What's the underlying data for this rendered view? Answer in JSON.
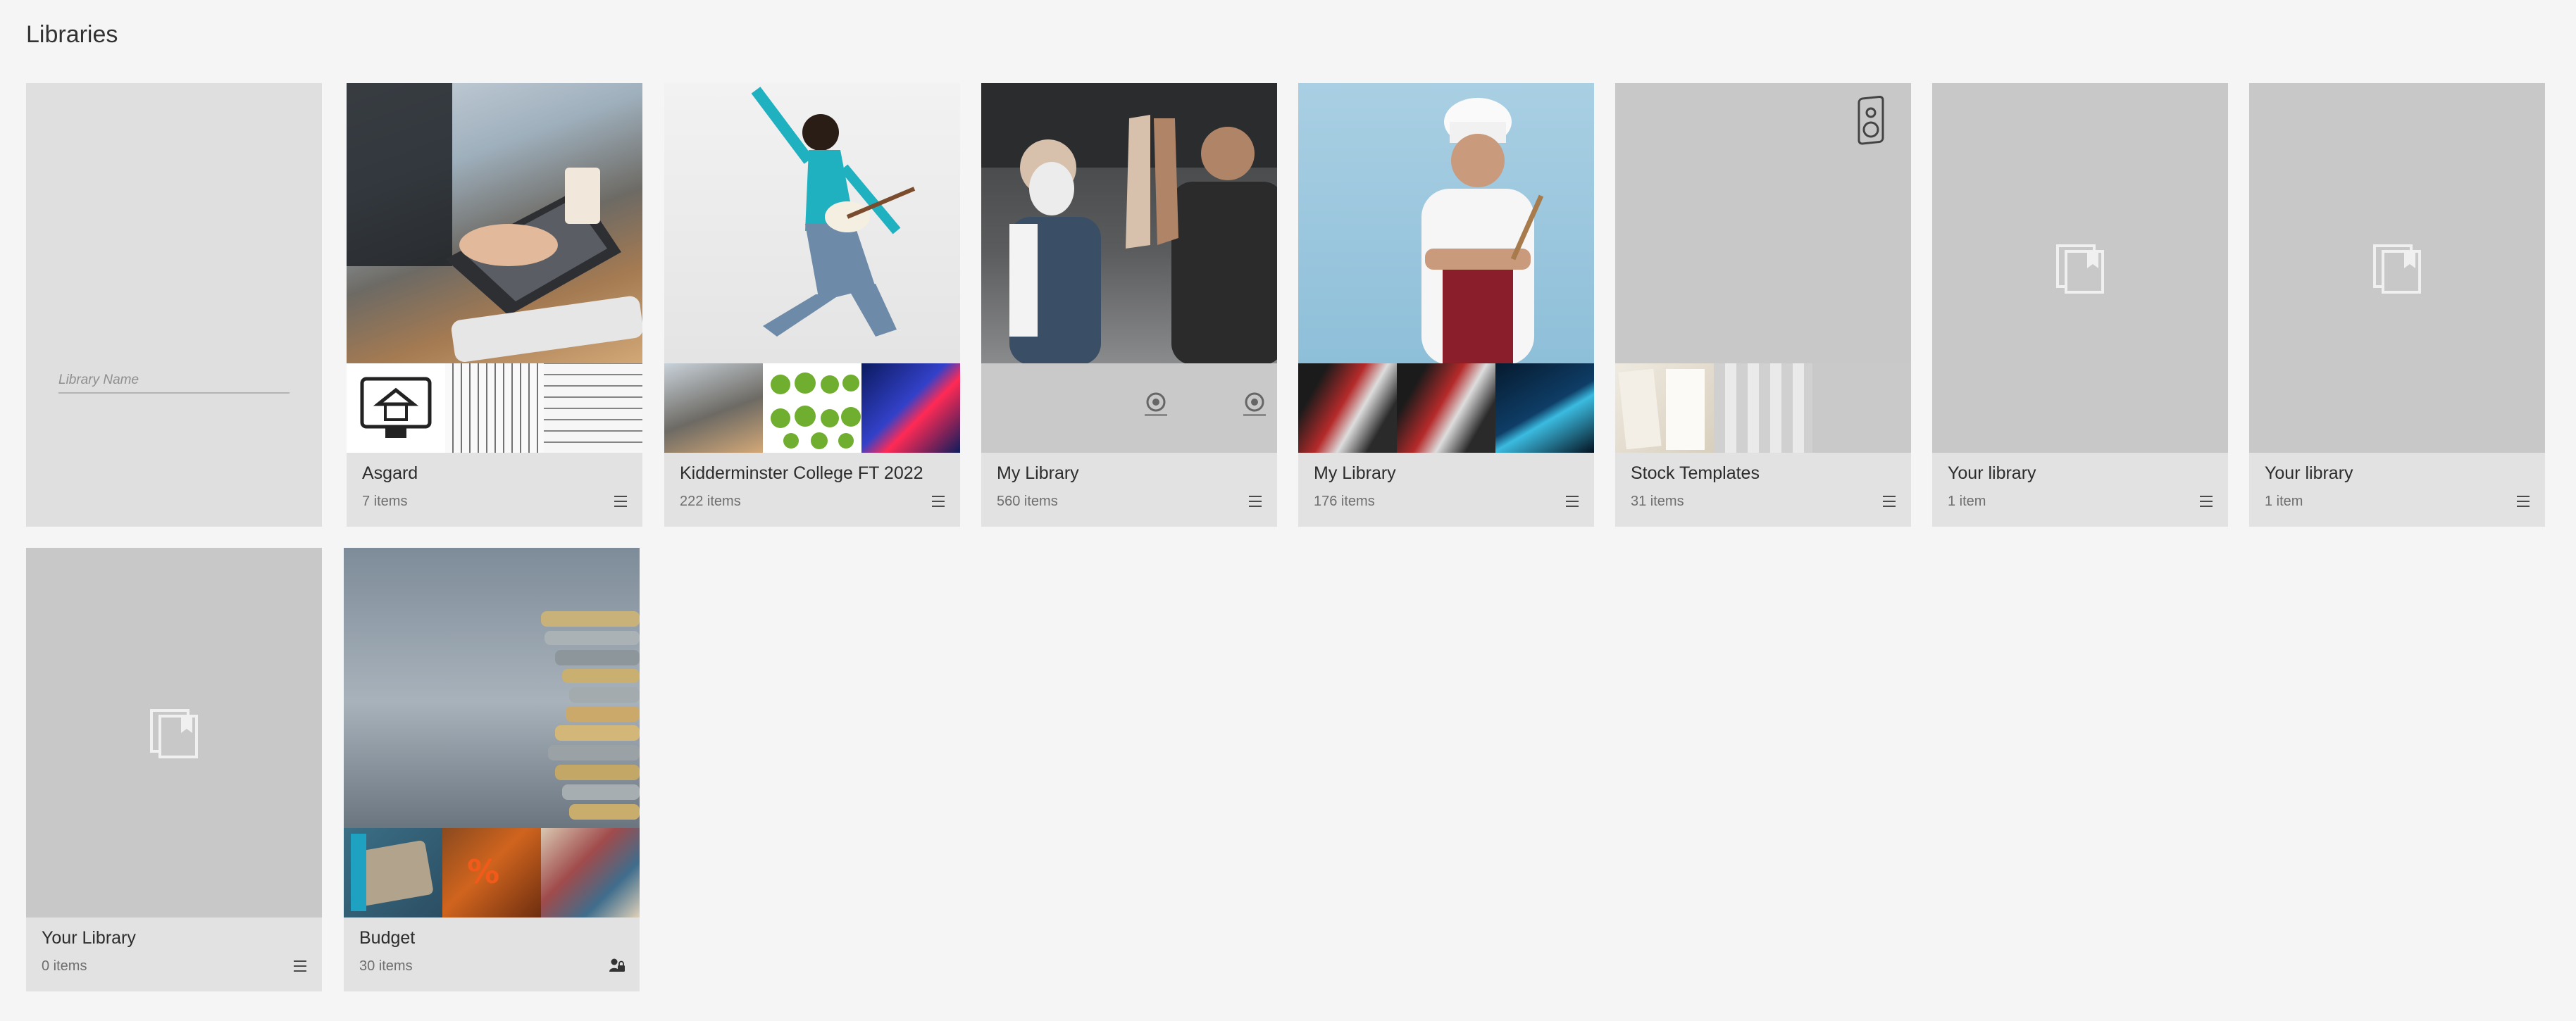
{
  "page": {
    "title": "Libraries"
  },
  "new_library": {
    "placeholder": "Library Name"
  },
  "libraries": [
    {
      "name": "Asgard",
      "count": "7 items",
      "action": "menu"
    },
    {
      "name": "Kidderminster College FT 2022",
      "count": "222 items",
      "action": "menu"
    },
    {
      "name": "My Library",
      "count": "560 items",
      "action": "menu"
    },
    {
      "name": "My Library",
      "count": "176 items",
      "action": "menu"
    },
    {
      "name": "Stock Templates",
      "count": "31 items",
      "action": "menu"
    },
    {
      "name": "Your library",
      "count": "1 item",
      "action": "menu"
    },
    {
      "name": "Your library",
      "count": "1 item",
      "action": "menu"
    },
    {
      "name": "Your Library",
      "count": "0 items",
      "action": "menu"
    },
    {
      "name": "Budget",
      "count": "30 items",
      "action": "shared-user"
    }
  ],
  "icons": {
    "menu": "hamburger-menu-icon",
    "library_placeholder": "library-placeholder-icon",
    "shared": "shared-user-icon",
    "speaker": "speaker-icon",
    "logo": "circular-logo-icon"
  },
  "colors": {
    "background": "#f5f5f5",
    "card": "#e2e2e2",
    "placeholder": "#c8c8c8"
  }
}
